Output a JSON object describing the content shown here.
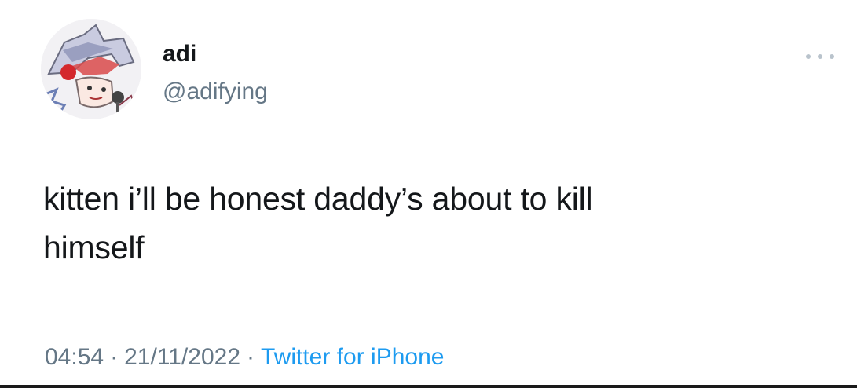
{
  "author": {
    "display_name": "adi",
    "handle": "@adifying",
    "avatar_icon": "anime-character-avatar"
  },
  "tweet": {
    "text_line1": "kitten i’ll be honest daddy’s about to kill",
    "text_line2": "himself"
  },
  "meta": {
    "time": "04:54",
    "date": "21/11/2022",
    "separator": "·",
    "source": "Twitter for iPhone"
  },
  "more_icon": "more-horizontal-icon",
  "colors": {
    "text": "#14171a",
    "secondary": "#657786",
    "link": "#1d9bf0"
  }
}
